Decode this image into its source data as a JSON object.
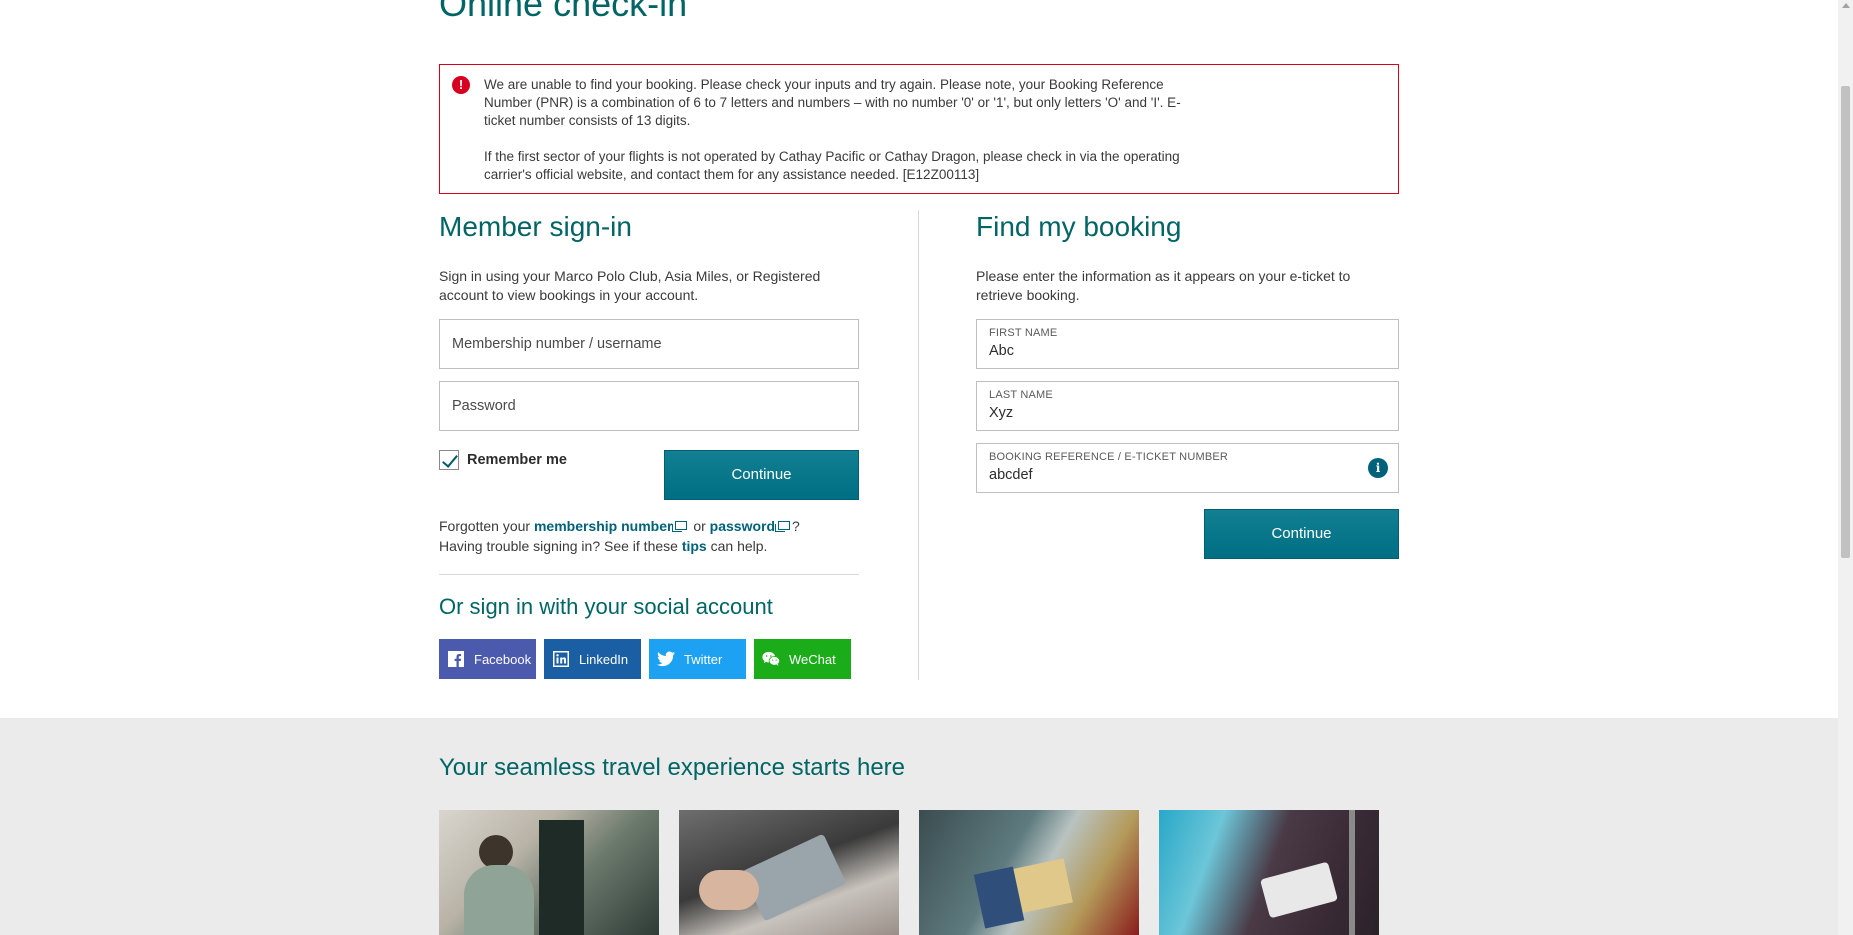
{
  "page": {
    "title": "Online check-in"
  },
  "error": {
    "paragraph1": "We are unable to find your booking. Please check your inputs and try again. Please note, your Booking Reference Number (PNR) is a combination of 6 to 7 letters and numbers – with no number '0' or '1', but only letters 'O' and 'I'. E-ticket number consists of 13 digits.",
    "paragraph2": "If the first sector of your flights is not operated by Cathay Pacific or Cathay Dragon, please check in via the operating carrier's official website, and contact them for any assistance needed. [E12Z00113]",
    "icon": "!"
  },
  "member_signin": {
    "title": "Member sign-in",
    "description": "Sign in using your Marco Polo Club, Asia Miles, or Registered account to view bookings in your account.",
    "username_placeholder": "Membership number / username",
    "password_placeholder": "Password",
    "remember_label": "Remember me",
    "remember_checked": true,
    "continue_label": "Continue",
    "forgot_prefix": "Forgotten your",
    "forgot_membership_link": "membership number",
    "forgot_or": "or",
    "forgot_password_link": "password",
    "forgot_suffix": "?",
    "trouble_prefix": "Having trouble signing in? See if these",
    "trouble_link": "tips",
    "trouble_suffix": "can help."
  },
  "social": {
    "title": "Or sign in with your social account",
    "buttons": [
      {
        "label": "Facebook",
        "icon": "facebook-icon",
        "color": "#4b5aad"
      },
      {
        "label": "LinkedIn",
        "icon": "linkedin-icon",
        "color": "#1a5fa3"
      },
      {
        "label": "Twitter",
        "icon": "twitter-icon",
        "color": "#1da1f2"
      },
      {
        "label": "WeChat",
        "icon": "wechat-icon",
        "color": "#1aad19"
      }
    ]
  },
  "find_booking": {
    "title": "Find my booking",
    "description": "Please enter the information as it appears on your e-ticket to retrieve booking.",
    "first_name_label": "FIRST NAME",
    "first_name_value": "Abc",
    "last_name_label": "LAST NAME",
    "last_name_value": "Xyz",
    "booking_ref_label": "BOOKING REFERENCE / E-TICKET NUMBER",
    "booking_ref_value": "abcdef",
    "continue_label": "Continue"
  },
  "promo": {
    "title": "Your seamless travel experience starts here"
  },
  "colors": {
    "brand_teal": "#006564",
    "button_teal": "#127f92",
    "error_red": "#d7001e"
  }
}
